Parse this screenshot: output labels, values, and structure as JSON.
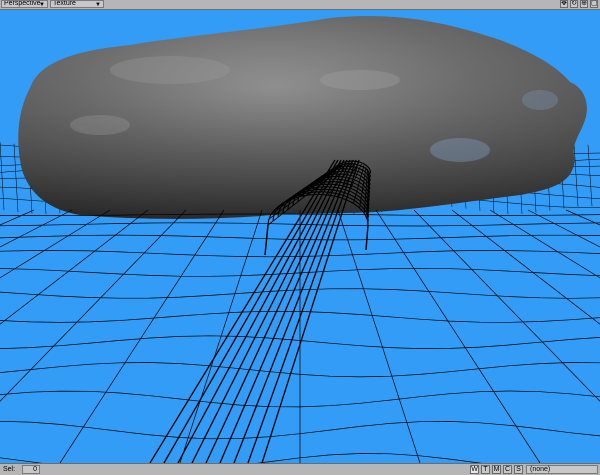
{
  "toolbar": {
    "view_mode": "Perspective",
    "render_mode": "Texture",
    "viewport_icons": [
      {
        "name": "move-icon",
        "glyph": "✥"
      },
      {
        "name": "rotate-icon",
        "glyph": "↻"
      },
      {
        "name": "zoom-icon",
        "glyph": "⊕"
      },
      {
        "name": "maximize-icon",
        "glyph": "▢"
      }
    ]
  },
  "viewport": {
    "background_color": "#339cf7",
    "wire_color": "#000000",
    "rock_color": "#5a5a5a"
  },
  "statusbar": {
    "sel_label": "Sel:",
    "sel_count": "0",
    "buttons": [
      {
        "label": "W",
        "active": true
      },
      {
        "label": "T",
        "active": false
      },
      {
        "label": "M",
        "active": false
      },
      {
        "label": "C",
        "active": false
      },
      {
        "label": "S",
        "active": false
      }
    ],
    "layer_value": "(none)"
  }
}
